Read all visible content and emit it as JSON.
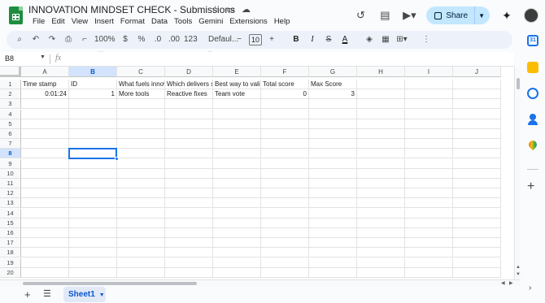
{
  "title": "INNOVATION MINDSET CHECK - Submissions",
  "menu": [
    "File",
    "Edit",
    "View",
    "Insert",
    "Format",
    "Data",
    "Tools",
    "Gemini",
    "Extensions",
    "Help"
  ],
  "share_label": "Share",
  "toolbar": {
    "zoom": "100%",
    "currency": "$",
    "percent": "%",
    "dec_decrease": ".0",
    "dec_increase": ".00",
    "number_format": "123",
    "font_family": "Defaul...",
    "font_size": "10",
    "bold": "B",
    "italic": "I",
    "strike": "S",
    "text_color": "A"
  },
  "name_box": "B8",
  "fx_label": "fx",
  "columns": [
    "A",
    "B",
    "C",
    "D",
    "E",
    "F",
    "G",
    "H",
    "I",
    "J"
  ],
  "selected_column": "B",
  "rows": [
    "1",
    "2",
    "3",
    "4",
    "5",
    "6",
    "7",
    "8",
    "9",
    "10",
    "11",
    "12",
    "13",
    "14",
    "15",
    "16",
    "17",
    "18",
    "19",
    "20"
  ],
  "selected_row": "8",
  "cells": {
    "A1": "Time stamp",
    "B1": "ID",
    "C1": "What fuels innov",
    "D1": "Which delivers s",
    "E1": "Best way to valid",
    "F1": "Total score",
    "G1": "Max Score",
    "A2": "0:01:24",
    "B2": "1",
    "C2": "More tools",
    "D2": "Reactive fixes",
    "E2": "Team vote",
    "F2": "0",
    "G2": "3"
  },
  "sheet_tab": "Sheet1",
  "side_calendar": "31"
}
